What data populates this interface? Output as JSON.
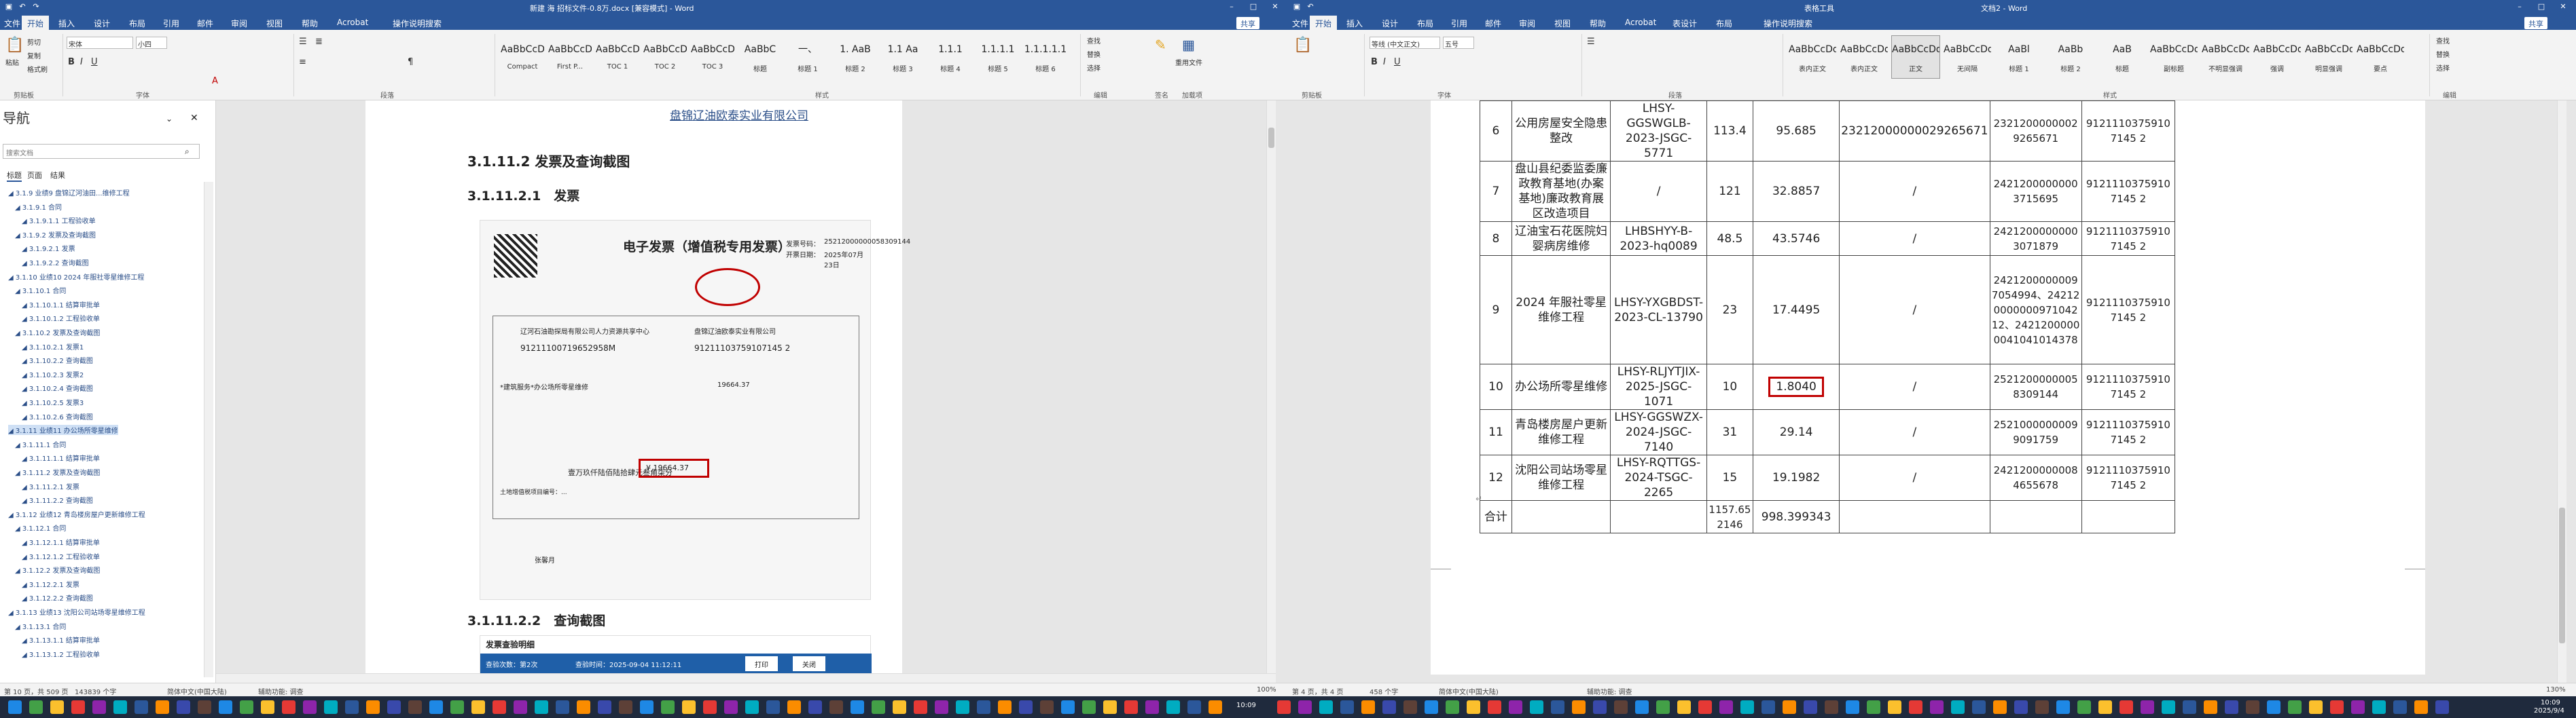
{
  "left": {
    "title": "新建 海 招标文件-0.8万.docx [兼容模式] - Word",
    "share": "共享",
    "menu": [
      "文件",
      "开始",
      "插入",
      "设计",
      "布局",
      "引用",
      "邮件",
      "审阅",
      "视图",
      "帮助",
      "Acrobat",
      "操作说明搜索"
    ],
    "ribbon": {
      "clipboard_label": "剪贴板",
      "font_label": "字体",
      "para_label": "段落",
      "styles_label": "样式",
      "edit_label": "编辑",
      "sign_label": "签名",
      "addin_label": "加载项",
      "font_name": "宋体",
      "font_size": "小四",
      "paste": "粘贴",
      "cut": "剪切",
      "copy": "复制",
      "format": "格式刷",
      "styles": [
        {
          "preview": "AaBbCcDd",
          "name": "Compact"
        },
        {
          "preview": "AaBbCcDd",
          "name": "First P..."
        },
        {
          "preview": "AaBbCcDd",
          "name": "TOC 1"
        },
        {
          "preview": "AaBbCcDd",
          "name": "TOC 2"
        },
        {
          "preview": "AaBbCcDd",
          "name": "TOC 3"
        },
        {
          "preview": "AaBbC",
          "name": "标题"
        },
        {
          "preview": "一、",
          "name": "标题 1"
        },
        {
          "preview": "1. AaB",
          "name": "标题 2"
        },
        {
          "preview": "1.1 Aa",
          "name": "标题 3"
        },
        {
          "preview": "1.1.1",
          "name": "标题 4"
        },
        {
          "preview": "1.1.1.1",
          "name": "标题 5"
        },
        {
          "preview": "1.1.1.1.1",
          "name": "标题 6"
        }
      ],
      "find": "查找",
      "replace": "替换",
      "select": "选择",
      "reuse": "重用文件"
    },
    "nav": {
      "title": "导航",
      "search_placeholder": "搜索文档",
      "tabs": [
        "标题",
        "页面",
        "结果"
      ],
      "items": [
        "3.1.9 业绩9 盘锦辽河油田...维修工程",
        "3.1.9.1 合同",
        "3.1.9.1.1 工程验收单",
        "3.1.9.2 发票及查询截图",
        "3.1.9.2.1 发票",
        "3.1.9.2.2 查询截图",
        "3.1.10 业绩10 2024 年服社零星维修工程",
        "3.1.10.1 合同",
        "3.1.10.1.1 结算审批单",
        "3.1.10.1.2 工程验收单",
        "3.1.10.2 发票及查询截图",
        "3.1.10.2.1 发票1",
        "3.1.10.2.2 查询截图",
        "3.1.10.2.3 发票2",
        "3.1.10.2.4 查询截图",
        "3.1.10.2.5 发票3",
        "3.1.10.2.6 查询截图",
        "3.1.11 业绩11 办公场所零星维修",
        "3.1.11.1 合同",
        "3.1.11.1.1 结算审批单",
        "3.1.11.2 发票及查询截图",
        "3.1.11.2.1 发票",
        "3.1.11.2.2 查询截图",
        "3.1.12 业绩12 青岛楼房屋户更新维修工程",
        "3.1.12.1 合同",
        "3.1.12.1.1 结算审批单",
        "3.1.12.1.2 工程验收单",
        "3.1.12.2 发票及查询截图",
        "3.1.12.2.1 发票",
        "3.1.12.2.2 查询截图",
        "3.1.13 业绩13 沈阳公司站场零星维修工程",
        "3.1.13.1 合同",
        "3.1.13.1.1 结算审批单",
        "3.1.13.1.2 工程验收单"
      ]
    },
    "doc": {
      "company": "盘锦辽油欧泰实业有限公司",
      "heading1": "3.1.11.2 发票及查询截图",
      "heading2": "3.1.11.2.1　发票",
      "heading3": "3.1.11.2.2　查询截图",
      "invoice": {
        "title": "电子发票（增值税专用发票）",
        "no_label": "发票号码：",
        "no": "25212000000058309144",
        "date_label": "开票日期：",
        "date": "2025年07月23日",
        "buyer": "辽河石油勘探局有限公司人力资源共享中心",
        "buyer_tax": "91211100719652958M",
        "seller": "盘锦辽油欧泰实业有限公司",
        "seller_tax": "91211103759107145 2",
        "item": "*建筑服务*办公场所零星维修",
        "amount": "19664.37",
        "total_words": "壹万玖仟陆佰陆拾肆元叁角柒分",
        "total": "¥ 19664.37",
        "remark": "土地增值税项目编号：...",
        "issuer": "张馨月"
      },
      "query_title": "发票查验明细",
      "query_count": "查验次数：第2次",
      "query_time": "查验时间：2025-09-04 11:12:11",
      "print": "打印",
      "close": "关闭"
    },
    "status": {
      "page": "第 10 页，共 509 页",
      "words": "143839 个字",
      "lang": "简体中文(中国大陆)",
      "access": "辅助功能: 调查",
      "zoom": "100%"
    }
  },
  "right": {
    "title": "文档2 - Word",
    "tooltitle": "表格工具",
    "share": "共享",
    "menu": [
      "文件",
      "开始",
      "插入",
      "设计",
      "布局",
      "引用",
      "邮件",
      "审阅",
      "视图",
      "帮助",
      "Acrobat",
      "表设计",
      "布局",
      "操作说明搜索"
    ],
    "ribbon": {
      "clipboard_label": "剪贴板",
      "font_label": "字体",
      "para_label": "段落",
      "styles_label": "样式",
      "edit_label": "编辑",
      "font_name": "等线 (中文正文)",
      "font_size": "五号",
      "styles": [
        {
          "preview": "AaBbCcDd",
          "name": "表内正文"
        },
        {
          "preview": "AaBbCcDd",
          "name": "表内正文"
        },
        {
          "preview": "AaBbCcDd",
          "name": "正文"
        },
        {
          "preview": "AaBbCcDd",
          "name": "无间隔"
        },
        {
          "preview": "AaBl",
          "name": "标题 1"
        },
        {
          "preview": "AaBb",
          "name": "标题 2"
        },
        {
          "preview": "AaB",
          "name": "标题"
        },
        {
          "preview": "AaBbCcDd",
          "name": "副标题"
        },
        {
          "preview": "AaBbCcDd",
          "name": "不明显强调"
        },
        {
          "preview": "AaBbCcDd",
          "name": "强调"
        },
        {
          "preview": "AaBbCcDd",
          "name": "明显强调"
        },
        {
          "preview": "AaBbCcDd",
          "name": "要点"
        }
      ],
      "find": "查找",
      "replace": "替换",
      "select": "选择"
    },
    "table": {
      "rows": [
        {
          "no": "6",
          "name": "公用房屋安全隐患整改",
          "code": "LHSY-GGSWGLB-2023-JSGC-5771",
          "area": "113.4",
          "amount": "95.685",
          "c6": "23212000000029265671",
          "inv": "23212000000029265671",
          "tax": "91211103759107145 2"
        },
        {
          "no": "7",
          "name": "盘山县纪委监委廉政教育基地(办案基地)廉政教育展区改造项目",
          "code": "/",
          "area": "121",
          "amount": "32.8857",
          "c6": "/",
          "inv": "24212000000003715695",
          "tax": "91211103759107145 2"
        },
        {
          "no": "8",
          "name": "辽油宝石花医院妇婴病房维修",
          "code": "LHBSHYY-B-2023-hq0089",
          "area": "48.5",
          "amount": "43.5746",
          "c6": "/",
          "inv": "24212000000003071879",
          "tax": "91211103759107145 2"
        },
        {
          "no": "9",
          "name": "2024 年服社零星维修工程",
          "code": "LHSY-YXGBDST-2023-CL-13790",
          "area": "23",
          "amount": "17.4495",
          "c6": "/",
          "inv": "24212000000097054994、24212000000097104212、24212000000041041014378",
          "tax": "91211103759107145 2"
        },
        {
          "no": "10",
          "name": "办公场所零星维修",
          "code": "LHSY-RLJYTJIX-2025-JSGC-1071",
          "area": "10",
          "amount": "1.8040",
          "c6": "/",
          "inv": "25212000000058309144",
          "tax": "91211103759107145 2"
        },
        {
          "no": "11",
          "name": "青岛楼房屋户更新维修工程",
          "code": "LHSY-GGSWZX-2024-JSGC-7140",
          "area": "31",
          "amount": "29.14",
          "c6": "/",
          "inv": "25210000000099091759",
          "tax": "91211103759107145 2"
        },
        {
          "no": "12",
          "name": "沈阳公司站场零星维修工程",
          "code": "LHSY-RQTTGS-2024-TSGC-2265",
          "area": "15",
          "amount": "19.1982",
          "c6": "/",
          "inv": "24212000000084655678",
          "tax": "91211103759107145 2"
        }
      ],
      "total_label": "合计",
      "total_area": "1157.652146",
      "total_amount": "998.399343"
    },
    "status": {
      "page": "第 4 页，共 4 页",
      "words": "458 个字",
      "lang": "简体中文(中国大陆)",
      "access": "辅助功能: 调查",
      "zoom": "130%"
    }
  },
  "taskbar": {
    "time1": "10:09",
    "time2": "10:09",
    "date": "2025/9/4"
  },
  "colors": {
    "brand": "#2b579a",
    "highlight_box": "#c00000",
    "link": "#2a4e88"
  }
}
